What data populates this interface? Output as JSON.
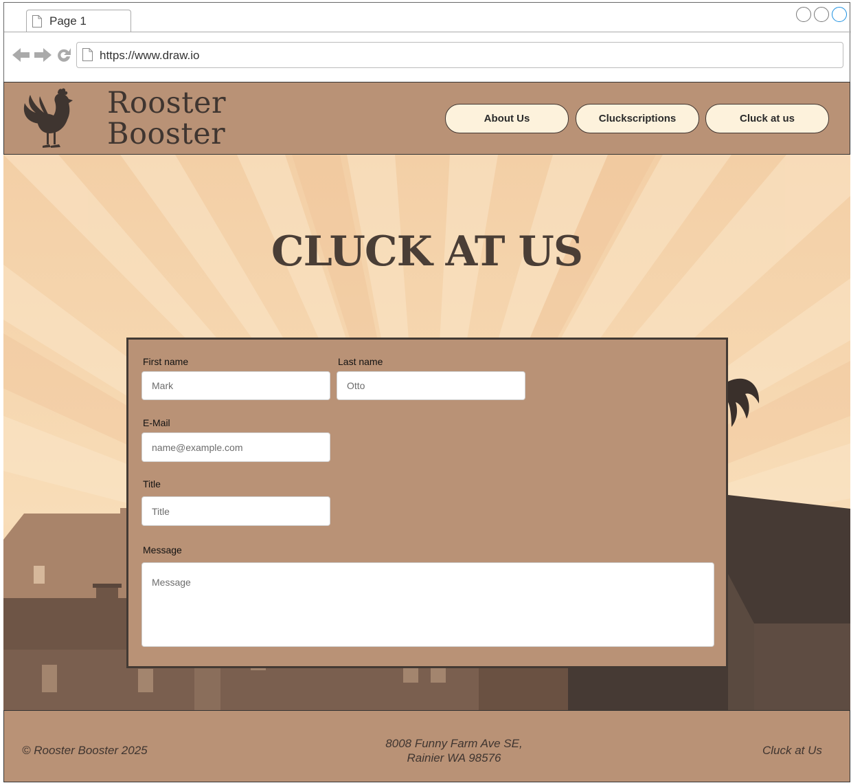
{
  "browser": {
    "tab_label": "Page 1",
    "url": "https://www.draw.io"
  },
  "header": {
    "brand_line1": "Rooster",
    "brand_line2": "Booster",
    "nav": [
      "About Us",
      "Cluckscriptions",
      "Cluck at us"
    ]
  },
  "hero": {
    "title": "CLUCK AT US"
  },
  "form": {
    "first_name_label": "First name",
    "first_name_placeholder": "Mark",
    "last_name_label": "Last name",
    "last_name_placeholder": "Otto",
    "email_label": "E-Mail",
    "email_placeholder": "name@example.com",
    "title_label": "Title",
    "title_placeholder": "Title",
    "message_label": "Message",
    "message_placeholder": "Message"
  },
  "footer": {
    "copyright": "© Rooster Booster 2025",
    "address_line1": "8008 Funny Farm Ave SE,",
    "address_line2": "Rainier WA 98576",
    "link": "Cluck at Us"
  },
  "colors": {
    "brand_brown": "#b99276",
    "dark_brown": "#3f3530",
    "button_cream": "#fdf2dc"
  }
}
